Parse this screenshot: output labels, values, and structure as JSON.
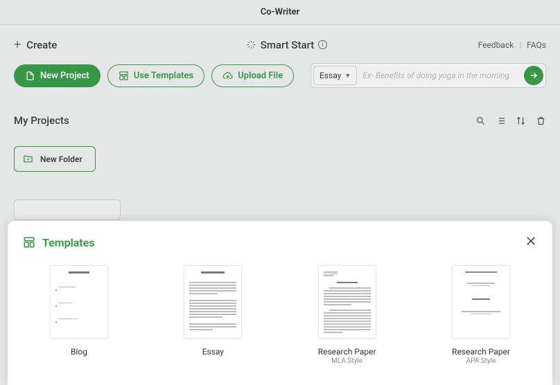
{
  "app": {
    "title": "Co-Writer"
  },
  "create": {
    "label": "Create"
  },
  "buttons": {
    "new_project": "New Project",
    "use_templates": "Use Templates",
    "upload_file": "Upload File"
  },
  "smart_start": {
    "label": "Smart Start",
    "type_selected": "Essay",
    "placeholder": "Ex- Benefits of doing yoga in the morning"
  },
  "header_links": {
    "feedback": "Feedback",
    "faqs": "FAQs"
  },
  "projects": {
    "title": "My Projects",
    "new_folder": "New Folder"
  },
  "modal": {
    "title": "Templates",
    "items": [
      {
        "name": "Blog",
        "sub": ""
      },
      {
        "name": "Essay",
        "sub": ""
      },
      {
        "name": "Research Paper",
        "sub": "MLA Style"
      },
      {
        "name": "Research Paper",
        "sub": "APA Style"
      }
    ]
  }
}
